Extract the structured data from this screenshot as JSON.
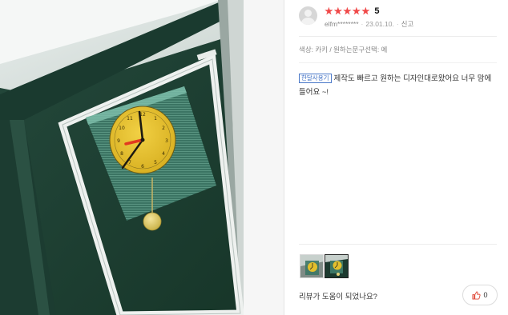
{
  "review": {
    "rating_label": "5",
    "stars_filled": 5,
    "stars_total": 5,
    "user": "elfm********",
    "date": "23.01.10.",
    "report_label": "신고",
    "options": "색상: 카키 / 원하는문구선택: 예",
    "badge": "한달사용기",
    "text": "제작도 빠르고 원하는 디자인대로왔어요 너무 맘에 들어요 ~!"
  },
  "helpful": {
    "question": "리뷰가 도움이 되었나요?",
    "count": "0"
  },
  "colors": {
    "star": "#f04848",
    "badge": "#3e6fc4",
    "wall_green": "#1e4134",
    "clock_face": "#e3bf2c"
  },
  "icons": [
    "avatar-icon",
    "star-icon",
    "thumbs-up-icon"
  ]
}
